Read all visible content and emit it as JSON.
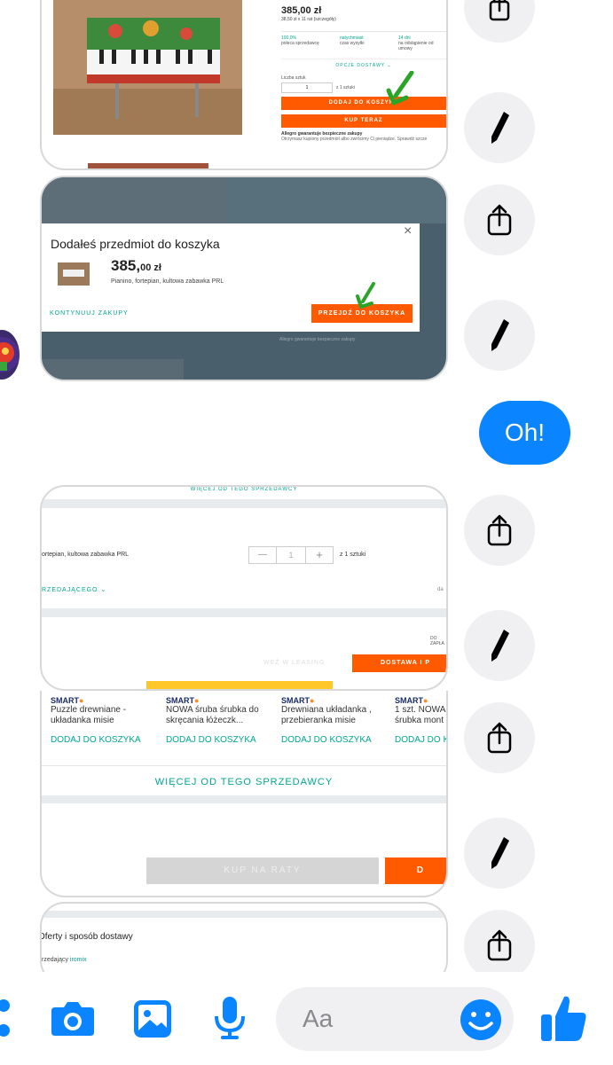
{
  "screenshot1": {
    "price": "385,00 zł",
    "installments": "38,50 zł x 11 rat (szczegóły)",
    "stats": [
      {
        "value": "100,0%",
        "label": "poleca sprzedawcę"
      },
      {
        "value": "natychmiast",
        "label": "czas wysyłki"
      },
      {
        "value": "14 dni",
        "label": "na odstąpienie od umowy"
      }
    ],
    "delivery_options": "OPCJE DOSTAWY",
    "quantity_label": "Liczba sztuk",
    "quantity_value": "1",
    "quantity_of": "z 1 sztuki",
    "add_to_cart": "DODAJ DO KOSZYKA",
    "buy_now": "KUP TERAZ",
    "guarantee_title": "Allegro gwarantuje bezpieczne zakupy",
    "guarantee_text": "Otrzymasz kupiony przedmiot albo zwrócimy Ci pieniądze. Sprawdź szcze"
  },
  "screenshot2": {
    "modal_title": "Dodałeś przedmiot do koszyka",
    "price_main": "385,",
    "price_cents": "00",
    "price_currency": " zł",
    "item_name": "Pianino, fortepian, kultowa zabawka PRL",
    "continue": "KONTYNUUJ ZAKUPY",
    "go_to_cart": "PRZEJDŹ DO KOSZYKA",
    "close": "×",
    "bg_guarantee": "Allegro gwarantuje bezpieczne zakupy"
  },
  "bubble_text": "Oh!",
  "screenshot3": {
    "more_from_seller": "WIĘCEJ OD TEGO SPRZEDAWCY",
    "item_name": "ortepian, kultowa zabawka PRL",
    "minus": "—",
    "qty": "1",
    "plus": "+",
    "qty_of": "z 1 sztuki",
    "seller_label": "RZEDAJĄCEGO",
    "right_cut": "da",
    "delivery_cut": "DO ZAPŁA",
    "leasing": "WEŹ W LEASING",
    "delivery_btn": "DOSTAWA I P"
  },
  "screenshot4": {
    "smart": "SMART",
    "products": [
      {
        "name": "Puzzle drewniane - układanka misie",
        "action": "DODAJ DO KOSZYKA"
      },
      {
        "name": "NOWA śruba śrubka do skręcania łóżeczk...",
        "action": "DODAJ DO KOSZYKA"
      },
      {
        "name": "Drewniana układanka , przebieranka misie",
        "action": "DODAJ DO KOSZYKA"
      },
      {
        "name": "1 szt. NOWA śrubka mont",
        "action": "DODAJ DO K"
      }
    ],
    "more_from_seller": "WIĘCEJ OD TEGO SPRZEDAWCY",
    "buy_installments": "KUP NA RATY",
    "orange_cut": "D"
  },
  "screenshot5": {
    "heading": "Oferty i sposób dostawy",
    "seller_prefix": "rzedający ",
    "seller_name": "iromix"
  },
  "composer": {
    "placeholder": "Aa"
  },
  "colors": {
    "messenger_blue": "#0a84ff",
    "allegro_orange": "#ff5a00",
    "teal": "#00a790",
    "overlay": "#4a5f6c"
  }
}
